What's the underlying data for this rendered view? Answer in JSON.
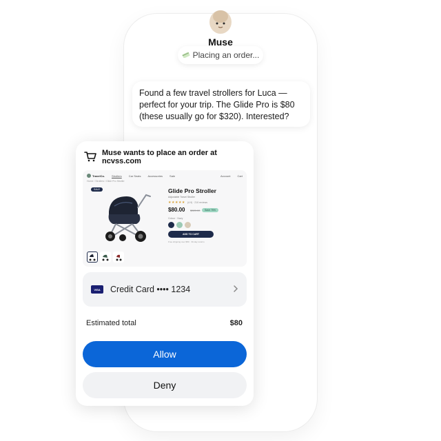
{
  "assistant": {
    "name": "Muse",
    "status": "Placing an order...",
    "status_icon": "card-icon"
  },
  "chat": {
    "message": "Found a few travel strollers for Luca — perfect for your trip. The Glide Pro is $80 (these usually go for $320). Interested?"
  },
  "permission": {
    "icon": "shopping-cart-icon",
    "title": "Muse wants to place an order at ncvss.com"
  },
  "product_preview": {
    "store_name": "TravelCo.",
    "nav": [
      "Strollers",
      "Car Seats",
      "Accessories",
      "Sale"
    ],
    "nav_right": [
      "Account",
      "Cart"
    ],
    "breadcrumb": "Home / Strollers / Glide Pro Stroller",
    "badge": "SALE",
    "title": "Glide Pro Stroller",
    "subtitle": "Adjustable Travel Stroller",
    "stars": "★★★★★",
    "reviews": "(4.9) · 210 reviews",
    "price": "$80.00",
    "was_price": "$320.00",
    "discount": "Save 75%",
    "color_label": "Colour · Navy",
    "swatches": [
      "#1d2a4a",
      "#9ccab5",
      "#d8cbb8"
    ],
    "add_to_cart": "ADD TO CART",
    "shipping_note": "Free shipping over $50 · 30-day returns"
  },
  "payment": {
    "card_brand": "VISA",
    "label": "Credit Card •••• 1234"
  },
  "total": {
    "label": "Estimated total",
    "amount": "$80"
  },
  "actions": {
    "allow": "Allow",
    "deny": "Deny"
  },
  "colors": {
    "allow_button": "#0b66d8",
    "deny_button": "#f1f2f4",
    "card_background": "#f2f3f5"
  }
}
